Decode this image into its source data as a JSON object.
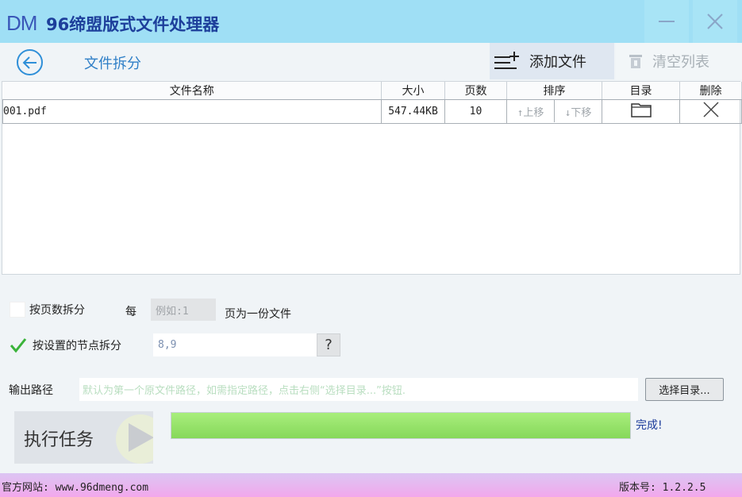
{
  "app": {
    "logo_text": "DM",
    "title": "96缔盟版式文件处理器"
  },
  "toolbar": {
    "page_title": "文件拆分",
    "add_file_label": "添加文件",
    "clear_list_label": "清空列表"
  },
  "table": {
    "columns": [
      "文件名称",
      "大小",
      "页数",
      "排序",
      "目录",
      "删除"
    ],
    "rows": [
      {
        "name": "001.pdf",
        "size": "547.44KB",
        "pages": "10",
        "move_up": "↑上移",
        "move_down": "↓下移"
      }
    ]
  },
  "options": {
    "by_pages_label": "按页数拆分",
    "by_pages_checked": false,
    "every_label": "每",
    "pages_placeholder": "例如:1",
    "pages_suffix": "页为一份文件",
    "by_bookmark_label": "按设置的节点拆分",
    "by_bookmark_checked": true,
    "bookmark_value": "8,9",
    "help_label": "?"
  },
  "output": {
    "label": "输出路径",
    "placeholder": "默认为第一个原文件路径，如需指定路径，点击右侧“选择目录...”按钮.",
    "choose_label": "选择目录..."
  },
  "run": {
    "label": "执行任务",
    "progress_percent": 100,
    "status": "完成!"
  },
  "footer": {
    "site": "官方网站:  www.96dmeng.com",
    "version": "版本号: 1.2.2.5"
  },
  "colors": {
    "titlebar": "#9fdff5",
    "accent": "#2f8fd8",
    "progress": "#86d85a",
    "check": "#3ab33a"
  }
}
